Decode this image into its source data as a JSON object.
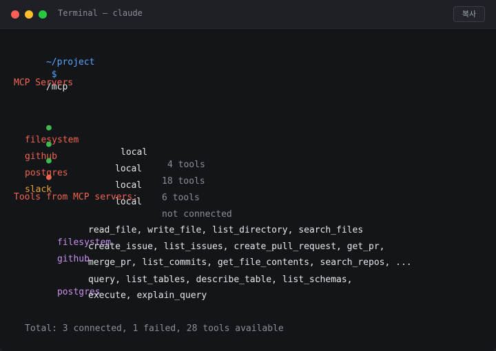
{
  "window": {
    "title": "Terminal — claude",
    "copy_label": "복사",
    "traffic_lights": {
      "red": "#ff5f57",
      "yellow": "#febc2e",
      "green": "#28c840"
    }
  },
  "prompt": {
    "path": "~/project",
    "symbol": "$",
    "command": "/mcp"
  },
  "mcp_servers": {
    "heading": "MCP Servers",
    "servers": [
      {
        "bullet": "●",
        "name": "filesystem",
        "type": "local",
        "status": "4 tools",
        "state": "ok"
      },
      {
        "bullet": "●",
        "name": "github",
        "type": "local",
        "status": "18 tools",
        "state": "ok"
      },
      {
        "bullet": "●",
        "name": "postgres",
        "type": "local",
        "status": "6 tools",
        "state": "ok"
      },
      {
        "bullet": "●",
        "name": "slack",
        "type": "local",
        "status": "not connected",
        "state": "failed"
      }
    ]
  },
  "tools": {
    "heading": "Tools from MCP servers:",
    "groups": [
      {
        "server": "filesystem",
        "lines": [
          "read_file, write_file, list_directory, search_files"
        ]
      },
      {
        "server": "github",
        "lines": [
          "create_issue, list_issues, create_pull_request, get_pr,",
          "merge_pr, list_commits, get_file_contents, search_repos, ..."
        ]
      },
      {
        "server": "postgres",
        "lines": [
          "query, list_tables, describe_table, list_schemas,",
          "execute, explain_query"
        ]
      }
    ]
  },
  "summary": "Total: 3 connected, 1 failed, 28 tools available"
}
